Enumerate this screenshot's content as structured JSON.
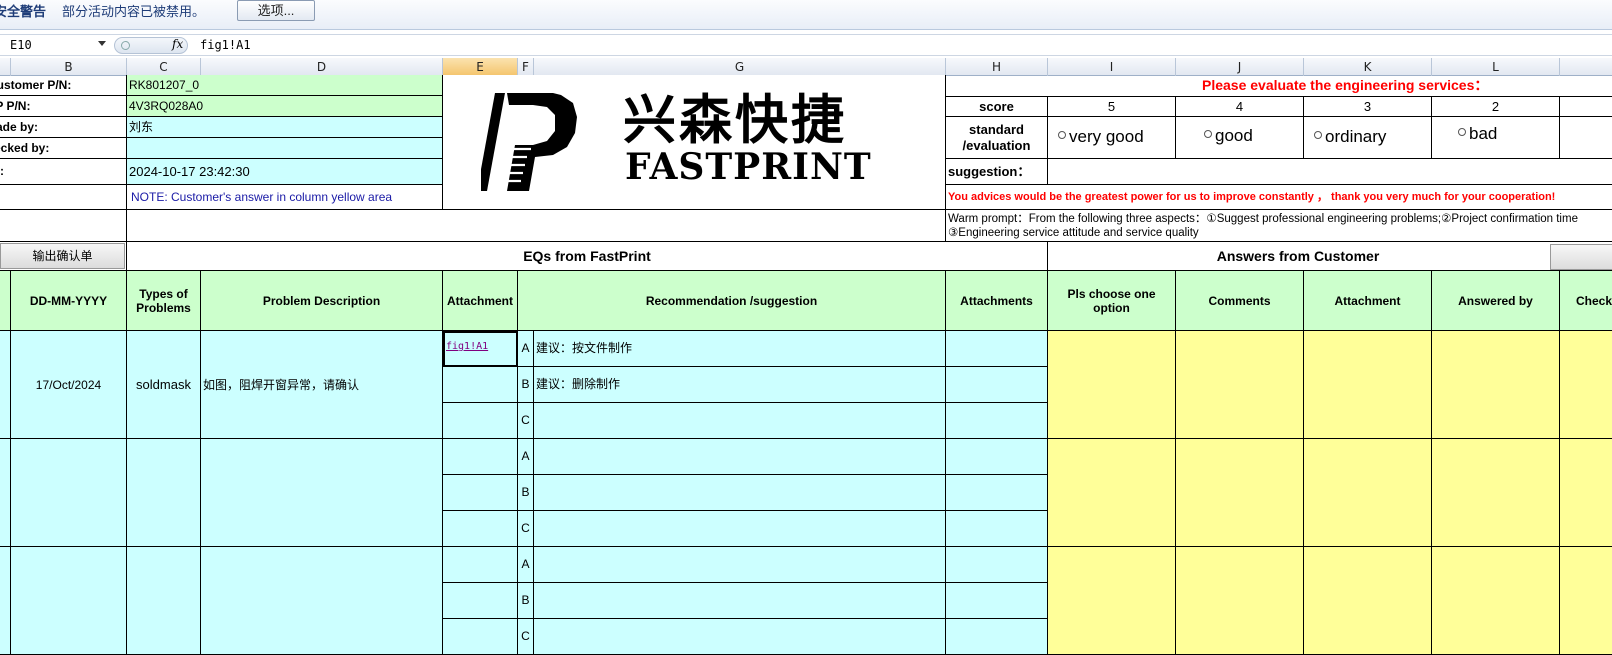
{
  "security_bar": {
    "title": "安全警告",
    "message": "部分活动内容已被禁用。",
    "options_button": "选项..."
  },
  "formula_bar": {
    "name_box": "E10",
    "fx": "fx",
    "formula": "fig1!A1"
  },
  "columns": {
    "b": "B",
    "c": "C",
    "d": "D",
    "e": "E",
    "f": "F",
    "g": "G",
    "h": "H",
    "i": "I",
    "j": "J",
    "k": "K",
    "l": "L"
  },
  "info": {
    "customer_pn_label": "Customer P/N:",
    "customer_pn": "RK801207_0",
    "pn_label": "FP P/N:",
    "pn": "4V3RQ028A0",
    "made_by_label": "Made by:",
    "made_by": "刘东",
    "checked_by_label": "Checked by:",
    "checked_by": "",
    "date_label": "Date:",
    "date": "2024-10-17 23:42:30",
    "note": "NOTE: Customer's  answer in column yellow area"
  },
  "logo": {
    "cn": "兴森快捷",
    "en": "FASTPRINT"
  },
  "evaluation": {
    "title": "Please evaluate the engineering services：",
    "score_label": "score",
    "scores": [
      "5",
      "4",
      "3",
      "2"
    ],
    "standard_label": "standard /evaluation",
    "options": [
      "very good",
      "good",
      "ordinary",
      "bad"
    ],
    "suggestion_label": "suggestion：",
    "advice": "You advices would be the greatest power for us to improve constantly ，  thank you very much for your cooperation!",
    "warm_prompt_1": "Warm prompt：From the following three aspects：①Suggest professional engineering problems;②Project confirmation time",
    "warm_prompt_2": "③Engineering service attitude and service quality"
  },
  "export_button": "输出确认单",
  "sections": {
    "eqs": "EQs from FastPrint",
    "answers": "Answers from Customer"
  },
  "table_headers": {
    "date": "DD-MM-YYYY",
    "types": "Types of Problems",
    "description": "Problem Description",
    "attachment": "Attachment",
    "recommendation": "Recommendation /suggestion",
    "attachments": "Attachments",
    "choose": "Pls choose one option",
    "comments": "Comments",
    "attachment2": "Attachment",
    "answered_by": "Answered by",
    "check": "Check"
  },
  "rows": [
    {
      "date": "17/Oct/2024",
      "type": "soldmask",
      "description": "如图，阻焊开窗异常，请确认",
      "attachment_link": "fig1!A1",
      "options": [
        {
          "letter": "A",
          "text": "建议：按文件制作"
        },
        {
          "letter": "B",
          "text": "建议：删除制作"
        },
        {
          "letter": "C",
          "text": ""
        }
      ]
    },
    {
      "date": "",
      "type": "",
      "description": "",
      "attachment_link": "",
      "options": [
        {
          "letter": "A",
          "text": ""
        },
        {
          "letter": "B",
          "text": ""
        },
        {
          "letter": "C",
          "text": ""
        }
      ]
    },
    {
      "date": "",
      "type": "",
      "description": "",
      "attachment_link": "",
      "options": [
        {
          "letter": "A",
          "text": ""
        },
        {
          "letter": "B",
          "text": ""
        },
        {
          "letter": "C",
          "text": ""
        }
      ]
    }
  ]
}
